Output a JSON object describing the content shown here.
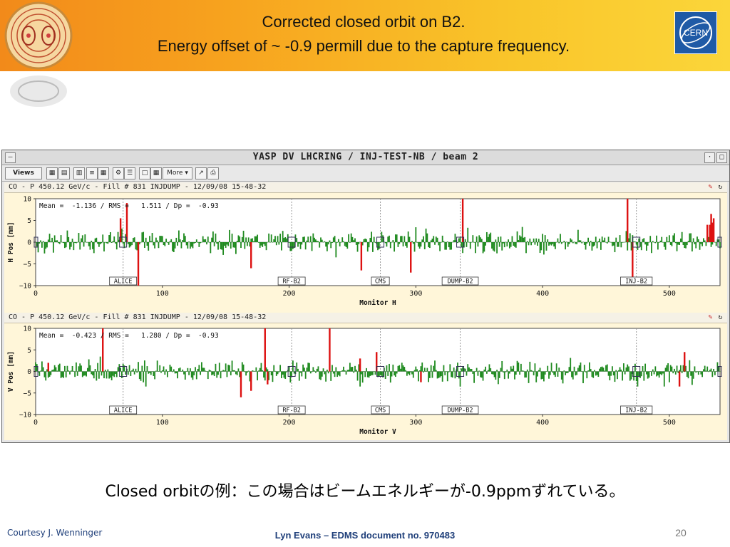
{
  "slide": {
    "title_line1": "Corrected closed orbit on B2.",
    "title_line2": "Energy offset of ~ -0.9 permill due to the capture frequency.",
    "caption": "Closed orbitの例：この場合はビームエネルギーが-0.9ppmずれている。",
    "courtesy": "Courtesy J. Wenninger",
    "footer": "Lyn Evans – EDMS document no. 970483",
    "page_number": "20",
    "cern_logo_text": "CERN"
  },
  "window": {
    "title": "YASP DV LHCRING / INJ-TEST-NB / beam 2",
    "toolbar": {
      "views_label": "Views",
      "more_label": "More"
    }
  },
  "colors": {
    "within_tolerance": "#1f8a1f",
    "out_of_tolerance": "#dd1111",
    "plot_background": "#fff6d9"
  },
  "panels": [
    {
      "header": "CO - P 450.12 GeV/c - Fill # 831 INJDUMP - 12/09/08 15-48-32",
      "stats": "Mean =  -1.136 / RMS =   1.511 / Dp =  -0.93",
      "ylabel": "H Pos [mm]",
      "xlabel": "Monitor H",
      "seed": 7
    },
    {
      "header": "CO - P 450.12 GeV/c - Fill # 831 INJDUMP - 12/09/08 15-48-32",
      "stats": "Mean =  -0.423 / RMS =   1.280 / Dp =  -0.93",
      "ylabel": "V Pos [mm]",
      "xlabel": "Monitor V",
      "seed": 19
    }
  ],
  "chart_data": [
    {
      "type": "bar",
      "title": "",
      "xlabel": "Monitor H",
      "ylabel": "H Pos [mm]",
      "xlim": [
        0,
        540
      ],
      "ylim": [
        -10,
        10
      ],
      "xticks": [
        0,
        100,
        200,
        300,
        400,
        500
      ],
      "yticks": [
        10,
        5,
        0,
        -5,
        -10
      ],
      "markers": [
        {
          "label": "ALICE",
          "x": 69
        },
        {
          "label": "RF-B2",
          "x": 202
        },
        {
          "label": "CMS",
          "x": 272
        },
        {
          "label": "DUMP-B2",
          "x": 335
        },
        {
          "label": "INJ-B2",
          "x": 474
        }
      ],
      "out_of_tolerance_spikes": [
        {
          "x": 67,
          "y": 5.5
        },
        {
          "x": 72,
          "y": 9.0
        },
        {
          "x": 81,
          "y": -10.0
        },
        {
          "x": 170,
          "y": -6.0
        },
        {
          "x": 257,
          "y": -6.5
        },
        {
          "x": 296,
          "y": -7.0
        },
        {
          "x": 337,
          "y": 10.0
        },
        {
          "x": 467,
          "y": 10.0
        },
        {
          "x": 471,
          "y": -8.0
        },
        {
          "x": 530,
          "y": 4.0
        },
        {
          "x": 532,
          "y": 4.0
        },
        {
          "x": 533,
          "y": 6.5
        },
        {
          "x": 534,
          "y": 4.5
        },
        {
          "x": 535,
          "y": 5.5
        }
      ],
      "note": "~540 green bars with typical amplitude within ±3 mm; values estimated"
    },
    {
      "type": "bar",
      "title": "",
      "xlabel": "Monitor V",
      "ylabel": "V Pos [mm]",
      "xlim": [
        0,
        540
      ],
      "ylim": [
        -10,
        10
      ],
      "xticks": [
        0,
        100,
        200,
        300,
        400,
        500
      ],
      "yticks": [
        10,
        5,
        0,
        -5,
        -10
      ],
      "markers": [
        {
          "label": "ALICE",
          "x": 69
        },
        {
          "label": "RF-B2",
          "x": 202
        },
        {
          "label": "CMS",
          "x": 272
        },
        {
          "label": "DUMP-B2",
          "x": 335
        },
        {
          "label": "INJ-B2",
          "x": 474
        }
      ],
      "out_of_tolerance_spikes": [
        {
          "x": 10,
          "y": 2.0
        },
        {
          "x": 53,
          "y": 10.0
        },
        {
          "x": 162,
          "y": -6.0
        },
        {
          "x": 170,
          "y": -4.5
        },
        {
          "x": 181,
          "y": 10.0
        },
        {
          "x": 183,
          "y": -3.0
        },
        {
          "x": 232,
          "y": 10.0
        },
        {
          "x": 256,
          "y": 3.0
        },
        {
          "x": 269,
          "y": 4.5
        },
        {
          "x": 304,
          "y": -2.5
        },
        {
          "x": 508,
          "y": -3.5
        },
        {
          "x": 512,
          "y": 4.5
        }
      ],
      "note": "~540 green bars with typical amplitude within ±3 mm; values estimated"
    }
  ]
}
